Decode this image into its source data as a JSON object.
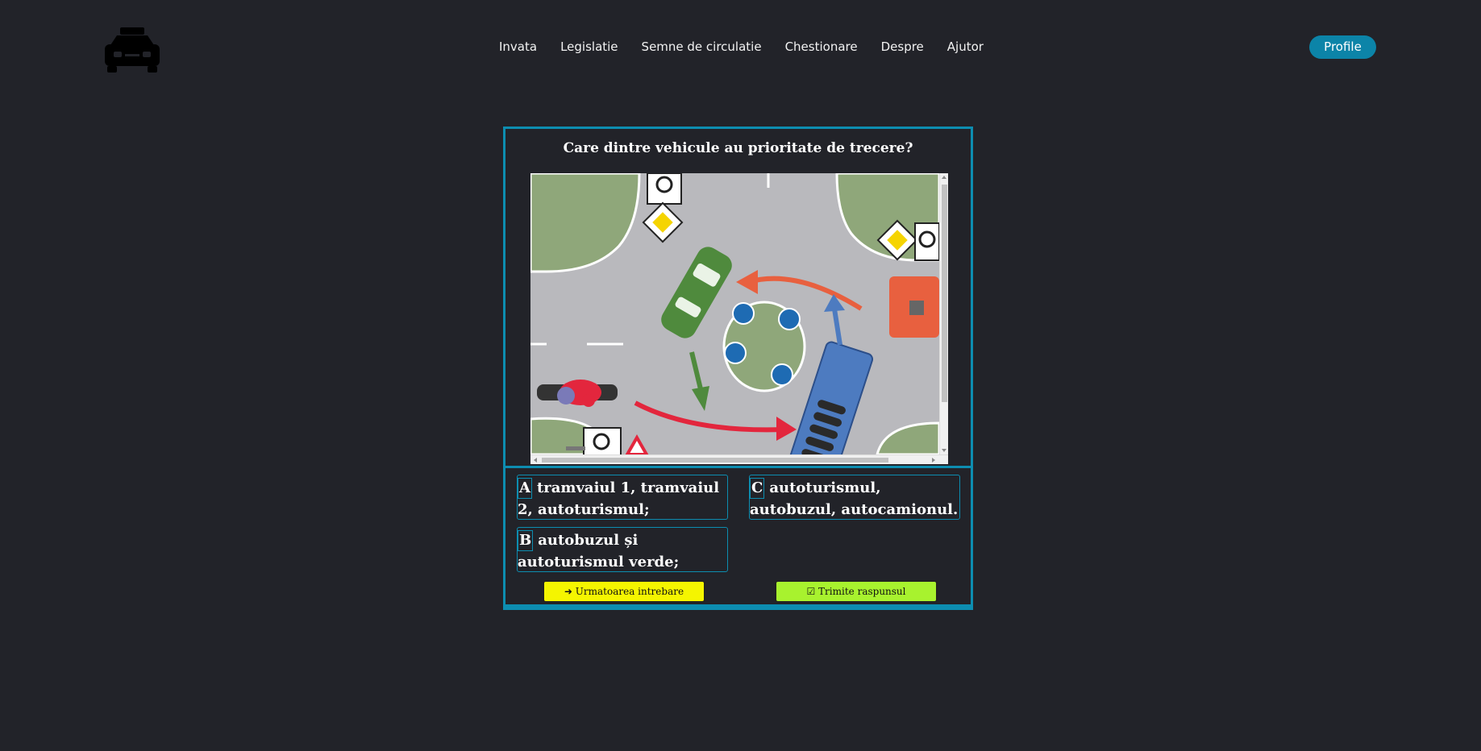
{
  "header": {
    "logo_icon": "taxi-car-icon",
    "nav": [
      "Invata",
      "Legislatie",
      "Semne de circulatie",
      "Chestionare",
      "Despre",
      "Ajutor"
    ],
    "profile_label": "Profile"
  },
  "quiz": {
    "question": "Care dintre vehicule au prioritate de trecere?",
    "image_icon": "roundabout-intersection-illustration",
    "answers": {
      "a": {
        "letter": "A",
        "text": "tramvaiul 1, tramvaiul 2, autoturismul;"
      },
      "b": {
        "letter": "B",
        "text": "autobuzul și autoturismul verde;"
      },
      "c": {
        "letter": "C",
        "text": "autoturismul, autobuzul, autocamionul."
      }
    },
    "next_label": "➜ Urmatoarea intrebare",
    "submit_label": "☑ Trimite raspunsul"
  },
  "colors": {
    "background": "#222329",
    "accent": "#0d8db0",
    "profile": "#0c84a8",
    "next_button": "#f5f500",
    "submit_button": "#a8f22e"
  }
}
